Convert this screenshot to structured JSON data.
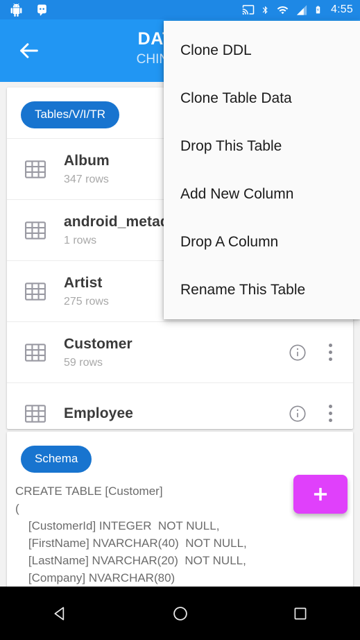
{
  "status_bar": {
    "time": "4:55",
    "left_icons": [
      "android-robot-icon",
      "android-head-icon"
    ],
    "right_icons": [
      "cast-icon",
      "bluetooth-icon",
      "wifi-icon",
      "cell-signal-icon",
      "battery-charging-icon"
    ],
    "background_color": "#1e88e5"
  },
  "app_bar": {
    "back_label": "back-arrow",
    "title": "DATABAS",
    "subtitle": "CHINOOK_SQ",
    "background_color": "#2196f3"
  },
  "tables_card": {
    "chip_label": "Tables/V/I/TR",
    "chip_color": "#1874cf",
    "rows": [
      {
        "name": "Album",
        "rows": "347 rows",
        "show_actions": false
      },
      {
        "name": "android_metada",
        "rows": "1 rows",
        "show_actions": false
      },
      {
        "name": "Artist",
        "rows": "275 rows",
        "show_actions": false
      },
      {
        "name": "Customer",
        "rows": "59 rows",
        "show_actions": true
      },
      {
        "name": "Employee",
        "rows": "",
        "show_actions": true
      }
    ]
  },
  "schema_card": {
    "chip_label": "Schema",
    "chip_color": "#1874cf",
    "text": "CREATE TABLE [Customer]\n(\n    [CustomerId] INTEGER  NOT NULL,\n    [FirstName] NVARCHAR(40)  NOT NULL,\n    [LastName] NVARCHAR(20)  NOT NULL,\n    [Company] NVARCHAR(80)"
  },
  "fab": {
    "icon": "plus-icon",
    "color": "#e040fb"
  },
  "popup_menu": {
    "items": [
      "Clone DDL",
      "Clone Table Data",
      "Drop This Table",
      "Add New Column",
      "Drop A Column",
      "Rename This Table"
    ]
  },
  "nav_bar": {
    "buttons": [
      "back-triangle-icon",
      "home-circle-icon",
      "recents-square-icon"
    ]
  }
}
